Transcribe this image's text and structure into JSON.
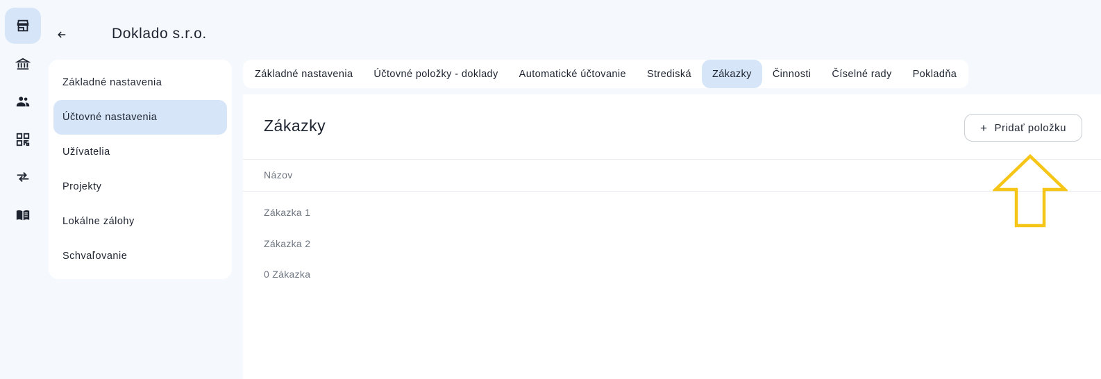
{
  "header": {
    "title": "Doklado s.r.o."
  },
  "rail": {
    "items": [
      {
        "icon": "store-icon",
        "active": true
      },
      {
        "icon": "bank-icon",
        "active": false
      },
      {
        "icon": "people-icon",
        "active": false
      },
      {
        "icon": "qr-code-icon",
        "active": false
      },
      {
        "icon": "swap-arrows-icon",
        "active": false
      },
      {
        "icon": "book-icon",
        "active": false
      }
    ]
  },
  "sidebar": {
    "items": [
      {
        "label": "Základné nastavenia",
        "active": false
      },
      {
        "label": "Účtovné nastavenia",
        "active": true
      },
      {
        "label": "Užívatelia",
        "active": false
      },
      {
        "label": "Projekty",
        "active": false
      },
      {
        "label": "Lokálne zálohy",
        "active": false
      },
      {
        "label": "Schvaľovanie",
        "active": false
      }
    ]
  },
  "tabs": [
    {
      "label": "Základné nastavenia",
      "active": false
    },
    {
      "label": "Účtovné položky - doklady",
      "active": false
    },
    {
      "label": "Automatické účtovanie",
      "active": false
    },
    {
      "label": "Strediská",
      "active": false
    },
    {
      "label": "Zákazky",
      "active": true
    },
    {
      "label": "Činnosti",
      "active": false
    },
    {
      "label": "Číselné rady",
      "active": false
    },
    {
      "label": "Pokladňa",
      "active": false
    }
  ],
  "main": {
    "title": "Zákazky",
    "add_button_label": "Pridať položku",
    "add_button_icon": "plus-icon",
    "table": {
      "columns": [
        "Názov"
      ],
      "rows": [
        "Zákazka 1",
        "Zákazka 2",
        "0 Zákazka"
      ]
    }
  },
  "colors": {
    "accent_bg": "#d6e5f8",
    "annotation_arrow": "#f5c518",
    "text_primary": "#1d2430",
    "text_muted": "#6d7580"
  }
}
